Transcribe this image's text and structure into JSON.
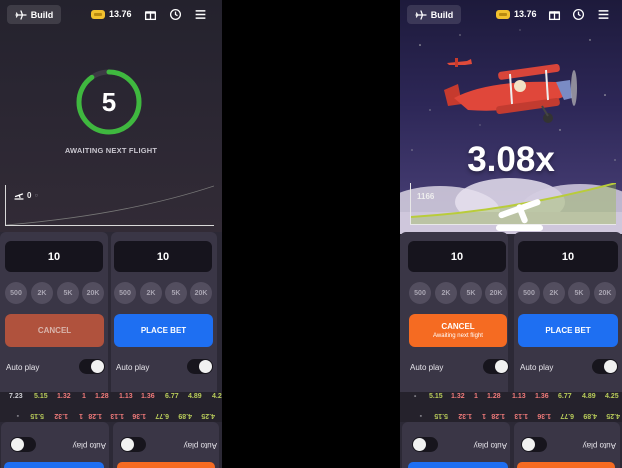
{
  "header": {
    "build_label": "Build",
    "balance": "13.76",
    "icons": [
      "gift-icon",
      "history-icon",
      "menu-icon"
    ]
  },
  "left": {
    "countdown": "5",
    "status": "AWAITING NEXT FLIGHT",
    "players": "0",
    "bet1": {
      "amount": "10",
      "chips": [
        "500",
        "2K",
        "5K",
        "20K"
      ],
      "action": "CANCEL",
      "auto_label": "Auto play"
    },
    "bet2": {
      "amount": "10",
      "chips": [
        "500",
        "2K",
        "5K",
        "20K"
      ],
      "action": "PLACE BET",
      "auto_label": "Auto play"
    },
    "history_top": [
      "7.23",
      "5.15",
      "1.32",
      "1",
      "1.28",
      "1.13",
      "1.36",
      "6.77",
      "4.89",
      "4.2"
    ],
    "history_mirrored": [
      "4.25",
      "4.89",
      "6.77",
      "1.36",
      "1.13",
      "1.28",
      "1",
      "1.32",
      "5.15",
      "-"
    ],
    "bottom_auto_1": "Auto play",
    "bottom_auto_2": "Auto play"
  },
  "right": {
    "multiplier": "3.08x",
    "players": "1166",
    "bet1": {
      "amount": "10",
      "chips": [
        "500",
        "2K",
        "5K",
        "20K"
      ],
      "action": "CANCEL",
      "action_sub": "Awaiting next flight",
      "auto_label": "Auto play"
    },
    "bet2": {
      "amount": "10",
      "chips": [
        "500",
        "2K",
        "5K",
        "20K"
      ],
      "action": "PLACE BET",
      "auto_label": "Auto play"
    },
    "history_top": [
      "-",
      "5.15",
      "1.32",
      "1",
      "1.28",
      "1.13",
      "1.36",
      "6.77",
      "4.89",
      "4.25"
    ],
    "history_mirrored": [
      "4.25",
      "4.89",
      "6.77",
      "1.36",
      "1.13",
      "1.28",
      "1",
      "1.32",
      "5.15",
      "-"
    ],
    "bottom_auto_1": "Auto play",
    "bottom_auto_2": "Auto play"
  },
  "colors": {
    "countdown_ring": "#3fb83f",
    "place_bet": "#1e6ff2",
    "cancel_active": "#f56b22",
    "cancel_dim": "#b0523d",
    "balance_coin": "#f2c12e"
  }
}
